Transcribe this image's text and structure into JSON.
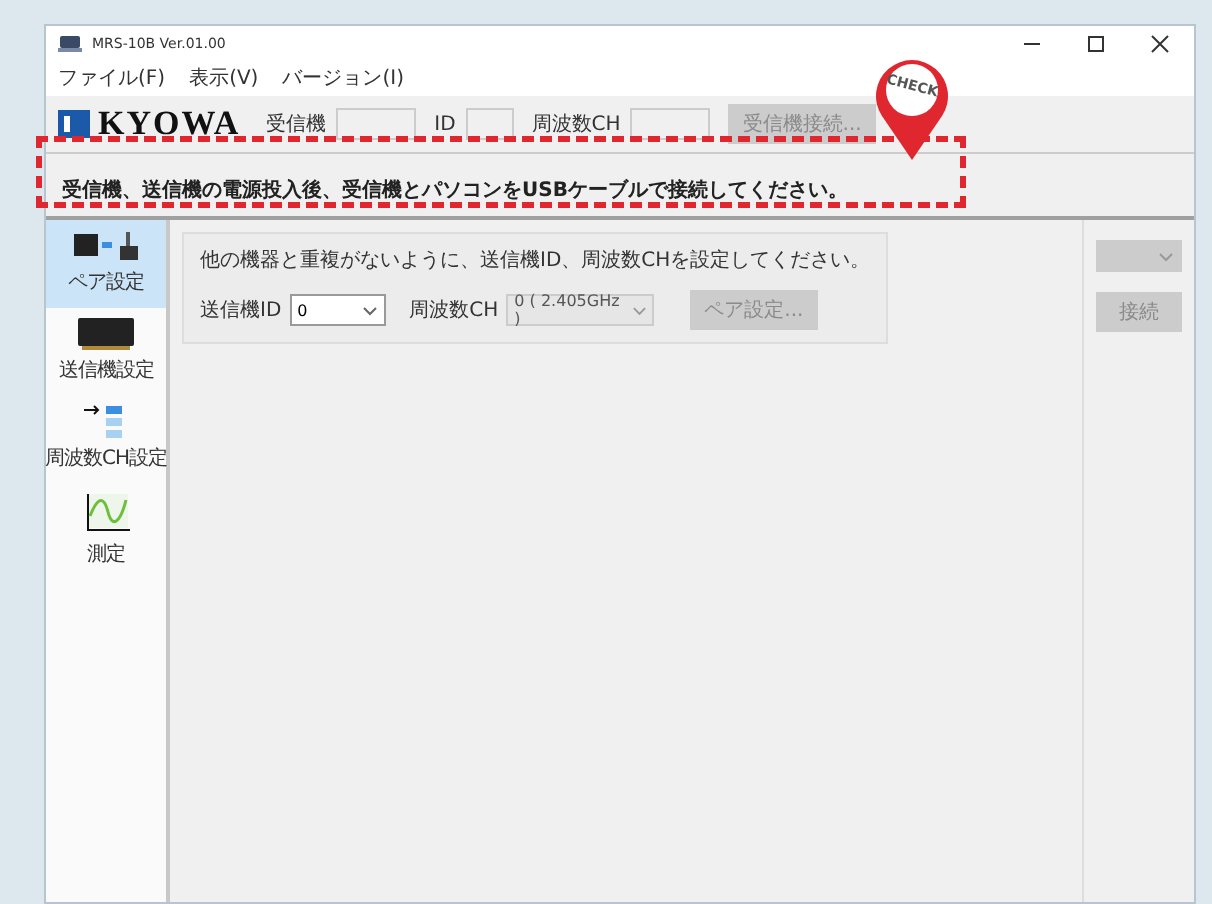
{
  "window": {
    "title": "MRS-10B Ver.01.00"
  },
  "menu": [
    "ファイル(F)",
    "表示(V)",
    "バージョン(I)"
  ],
  "header": {
    "logo": "KYOWA",
    "fields": [
      {
        "label": "受信機"
      },
      {
        "label": "ID"
      },
      {
        "label": "周波数CH"
      }
    ],
    "connect_button": {
      "label": "受信機接続...",
      "disabled": true
    }
  },
  "message": "受信機、送信機の電源投入後、受信機とパソコンをUSBケーブルで接続してください。",
  "sidebar": {
    "items": [
      {
        "label": "ペア設定",
        "kind": "pair",
        "selected": true
      },
      {
        "label": "送信機設定",
        "kind": "transmitter",
        "selected": false
      },
      {
        "label": "周波数CH設定",
        "kind": "frequency",
        "selected": false
      },
      {
        "label": "測定",
        "kind": "measure",
        "selected": false
      }
    ]
  },
  "pair_panel": {
    "instruction": "他の機器と重複がないように、送信機ID、周波数CHを設定してください。",
    "transmitter_id": {
      "label": "送信機ID",
      "value": "0"
    },
    "frequency_ch": {
      "label": "周波数CH",
      "value": "0 ( 2.405GHz )"
    },
    "pair_button": {
      "label": "ペア設定...",
      "disabled": true
    }
  },
  "right_panel": {
    "dropdown": {
      "disabled": true
    },
    "connect_button": {
      "label": "接続",
      "disabled": true
    }
  },
  "annotation": {
    "badge": "CHECK"
  }
}
